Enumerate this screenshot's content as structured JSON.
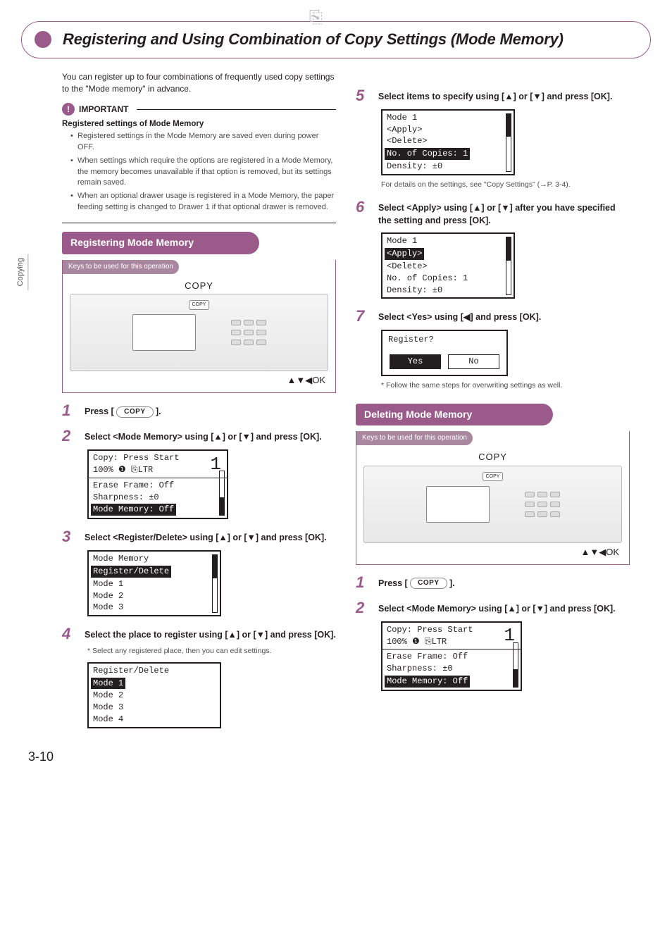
{
  "side_tab": "Copying",
  "title": "Registering and Using Combination of Copy Settings (Mode Memory)",
  "intro": "You can register up to four combinations of frequently used copy settings to the \"Mode memory\" in advance.",
  "important_label": "IMPORTANT",
  "important_heading": "Registered settings of Mode Memory",
  "important_bullets": [
    "Registered settings in the Mode Memory are saved even during power OFF.",
    "When settings which require the options are registered in a Mode Memory, the memory becomes unavailable if that option is removed, but its settings remain saved.",
    "When an optional drawer usage is registered in a Mode Memory, the paper feeding setting is changed to Drawer 1 if that optional drawer is removed."
  ],
  "sections": {
    "register": "Registering Mode Memory",
    "delete": "Deleting Mode Memory"
  },
  "panel": {
    "caption": "Keys to be used for this operation",
    "label": "COPY",
    "pill": "COPY",
    "foot": "▲▼◀OK"
  },
  "copy_button": "COPY",
  "steps_left": {
    "s1": {
      "pre": "Press [ ",
      "post": " ]."
    },
    "s2": "Select <Mode Memory> using [▲] or [▼] and press [OK].",
    "s3": "Select <Register/Delete> using [▲] or [▼] and press [OK].",
    "s4": "Select the place to register using [▲] or [▼] and press [OK].",
    "s4_note": "Select any registered place, then you can edit settings."
  },
  "steps_right": {
    "s5": "Select items to specify using [▲] or [▼] and press [OK].",
    "s5_ref": "For details on the settings, see \"Copy Settings\" (→P. 3-4).",
    "s6": "Select <Apply> using [▲] or [▼] after you have specified the setting and press [OK].",
    "s7": "Select <Yes> using [◀] and press [OK].",
    "s7_note": "Follow the same steps for overwriting settings as well.",
    "d1": {
      "pre": "Press [ ",
      "post": " ]."
    },
    "d2": "Select <Mode Memory> using [▲] or [▼] and press [OK]."
  },
  "lcd": {
    "copy_start": {
      "l1": "Copy: Press Start",
      "l2": "100% ❶ ⎘LTR",
      "one": "1",
      "b1": "Erase Frame: Off",
      "b2": "Sharpness: ±0",
      "b3": "Mode Memory: Off"
    },
    "mode_mem": {
      "title": "Mode Memory",
      "sel": "Register/Delete",
      "r1": "Mode 1",
      "r2": "Mode 2",
      "r3": "Mode 3"
    },
    "reg_del": {
      "title": "Register/Delete",
      "sel": "Mode 1",
      "r1": "Mode 2",
      "r2": "Mode 3",
      "r3": "Mode 4"
    },
    "mode1_a": {
      "title": "Mode 1",
      "r1": "<Apply>",
      "r2": "<Delete>",
      "sel": "No. of Copies: 1",
      "r3": "Density: ±0"
    },
    "mode1_b": {
      "title": "Mode 1",
      "sel": "<Apply>",
      "r1": "<Delete>",
      "r2": "No. of Copies: 1",
      "r3": "Density: ±0"
    },
    "confirm": {
      "q": "Register?",
      "yes": "Yes",
      "no": "No"
    }
  },
  "page_number": "3-10"
}
